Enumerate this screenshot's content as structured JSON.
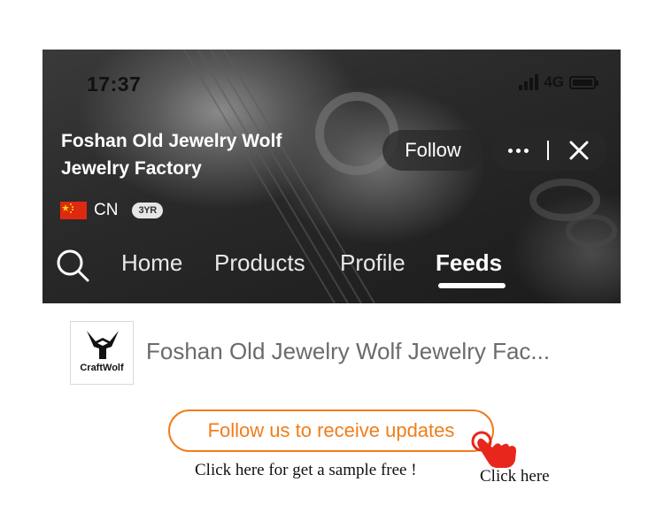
{
  "status_bar": {
    "time": "17:37",
    "network": "4G"
  },
  "header": {
    "company_name": "Foshan Old Jewelry Wolf Jewelry Factory",
    "follow_label": "Follow",
    "country_code": "CN",
    "years_badge": "3YR"
  },
  "nav": {
    "tabs": [
      {
        "label": "Home"
      },
      {
        "label": "Products"
      },
      {
        "label": "Profile"
      },
      {
        "label": "Feeds"
      }
    ],
    "active_tab": "Feeds"
  },
  "store": {
    "logo_text": "CraftWolf",
    "name": "Foshan Old Jewelry Wolf Jewelry Fac..."
  },
  "cta": {
    "follow_updates_label": "Follow us to receive updates",
    "sample_text": "Click here for get a sample free !",
    "click_here_label": "Click here"
  },
  "icons": {
    "search": "search-icon",
    "more": "more-icon",
    "close": "close-icon",
    "flag": "china-flag-icon",
    "hand": "pointing-hand-icon"
  },
  "colors": {
    "accent": "#f07d1a",
    "hand": "#e8261b",
    "header_text": "#ffffff"
  }
}
